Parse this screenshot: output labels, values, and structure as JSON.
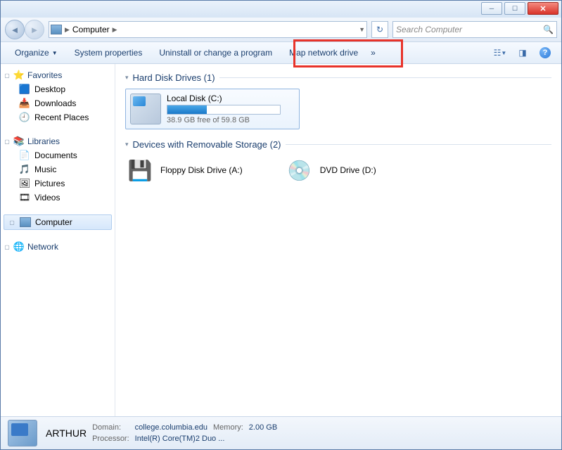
{
  "breadcrumb": {
    "root_icon": "computer-icon",
    "location": "Computer"
  },
  "search": {
    "placeholder": "Search Computer"
  },
  "toolbar": {
    "organize": "Organize",
    "system_properties": "System properties",
    "uninstall": "Uninstall or change a program",
    "map_drive": "Map network drive",
    "overflow": "»"
  },
  "sidebar": {
    "favorites": {
      "label": "Favorites",
      "items": [
        {
          "icon": "🟦",
          "label": "Desktop"
        },
        {
          "icon": "📥",
          "label": "Downloads"
        },
        {
          "icon": "🕘",
          "label": "Recent Places"
        }
      ]
    },
    "libraries": {
      "label": "Libraries",
      "items": [
        {
          "icon": "📄",
          "label": "Documents"
        },
        {
          "icon": "🎵",
          "label": "Music"
        },
        {
          "icon": "🖼",
          "label": "Pictures"
        },
        {
          "icon": "🎞",
          "label": "Videos"
        }
      ]
    },
    "computer": {
      "label": "Computer"
    },
    "network": {
      "label": "Network"
    }
  },
  "content": {
    "hard_drives": {
      "title": "Hard Disk Drives (1)",
      "items": [
        {
          "name": "Local Disk (C:)",
          "free": "38.9 GB free of 59.8 GB",
          "used_pct": 35
        }
      ]
    },
    "removable": {
      "title": "Devices with Removable Storage (2)",
      "items": [
        {
          "icon": "💾",
          "name": "Floppy Disk Drive (A:)"
        },
        {
          "icon": "💿",
          "name": "DVD Drive (D:)"
        }
      ]
    }
  },
  "status": {
    "computer_name": "ARTHUR",
    "domain_label": "Domain:",
    "domain": "college.columbia.edu",
    "memory_label": "Memory:",
    "memory": "2.00 GB",
    "processor_label": "Processor:",
    "processor": "Intel(R) Core(TM)2 Duo ..."
  }
}
